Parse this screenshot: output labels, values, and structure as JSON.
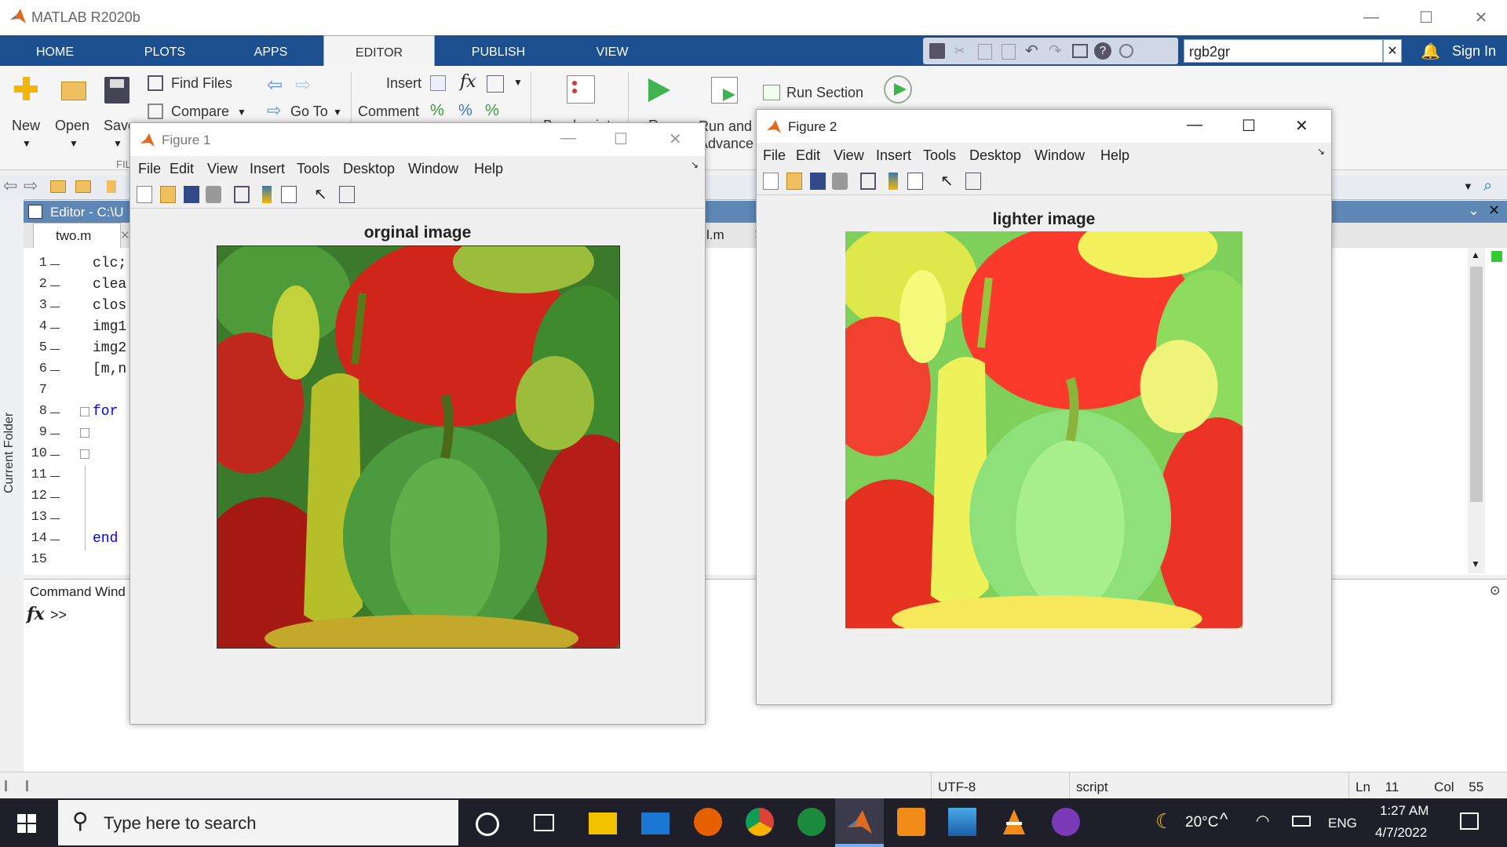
{
  "app": {
    "title": "MATLAB R2020b"
  },
  "window_controls": {
    "minimize": "—",
    "maximize": "☐",
    "close": "✕"
  },
  "ribbon": {
    "tabs": [
      "HOME",
      "PLOTS",
      "APPS",
      "EDITOR",
      "PUBLISH",
      "VIEW"
    ],
    "active_tab": "EDITOR",
    "search_value": "rgb2gr",
    "sign_in": "Sign In",
    "file": {
      "new": "New",
      "open": "Open",
      "save": "Save",
      "group": "FIL"
    },
    "navigate": {
      "find_files": "Find Files",
      "compare": "Compare",
      "go_to": "Go To"
    },
    "edit": {
      "insert": "Insert",
      "comment": "Comment"
    },
    "breakpoints": "Breakpoints",
    "run": {
      "run": "Run",
      "run_and_advance": "Run and Advance",
      "run_section": "Run Section"
    }
  },
  "editor": {
    "header": "Editor - C:\\U",
    "current_folder": "Current Folder",
    "tabs": [
      "two.m",
      "l.m"
    ],
    "lines": [
      {
        "n": "1",
        "dash": true,
        "code": "clc;",
        "kw": false
      },
      {
        "n": "2",
        "dash": true,
        "code": "clea",
        "kw": false
      },
      {
        "n": "3",
        "dash": true,
        "code": "clos",
        "kw": false
      },
      {
        "n": "4",
        "dash": true,
        "code": "img1",
        "kw": false
      },
      {
        "n": "5",
        "dash": true,
        "code": "img2",
        "kw": false
      },
      {
        "n": "6",
        "dash": true,
        "code": "[m,n",
        "kw": false
      },
      {
        "n": "7",
        "dash": false,
        "code": "",
        "kw": false
      },
      {
        "n": "8",
        "dash": true,
        "code": "for",
        "kw": true
      },
      {
        "n": "9",
        "dash": true,
        "code": "",
        "kw": false
      },
      {
        "n": "10",
        "dash": true,
        "code": "",
        "kw": false
      },
      {
        "n": "11",
        "dash": true,
        "code": "",
        "kw": false
      },
      {
        "n": "12",
        "dash": true,
        "code": "",
        "kw": false
      },
      {
        "n": "13",
        "dash": true,
        "code": "",
        "kw": false
      },
      {
        "n": "14",
        "dash": true,
        "code": "end",
        "kw": true
      },
      {
        "n": "15",
        "dash": false,
        "code": "",
        "kw": false
      }
    ]
  },
  "command_window": {
    "title": "Command Wind",
    "prompt": ">>",
    "fx": "fx"
  },
  "status": {
    "encoding": "UTF-8",
    "type": "script",
    "ln_label": "Ln",
    "ln": "11",
    "col_label": "Col",
    "col": "55"
  },
  "figure1": {
    "title": "Figure 1",
    "menu": [
      "File",
      "Edit",
      "View",
      "Insert",
      "Tools",
      "Desktop",
      "Window",
      "Help"
    ],
    "image_title": "orginal image"
  },
  "figure2": {
    "title": "Figure 2",
    "menu": [
      "File",
      "Edit",
      "View",
      "Insert",
      "Tools",
      "Desktop",
      "Window",
      "Help"
    ],
    "image_title": "lighter image"
  },
  "taskbar": {
    "search_placeholder": "Type here to search",
    "weather": "20°C",
    "language": "ENG",
    "time": "1:27 AM",
    "date": "4/7/2022"
  },
  "colors": {
    "ribbon_blue": "#1b4f8f",
    "editor_header": "#5e87b6",
    "taskbar": "#1f1f2a",
    "keyword": "#0000ff"
  }
}
